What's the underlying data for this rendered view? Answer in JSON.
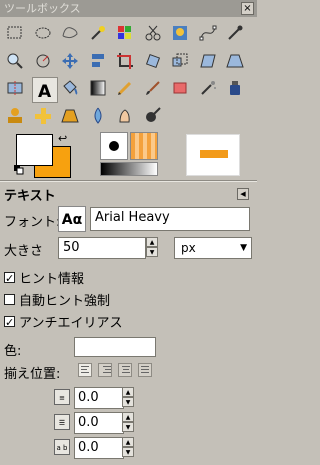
{
  "window": {
    "title": "ツールボックス",
    "close_glyph": "×"
  },
  "tools": [
    {
      "name": "rect-select-icon"
    },
    {
      "name": "ellipse-select-icon"
    },
    {
      "name": "free-select-icon"
    },
    {
      "name": "fuzzy-select-icon"
    },
    {
      "name": "color-select-icon"
    },
    {
      "name": "scissors-select-icon"
    },
    {
      "name": "foreground-select-icon"
    },
    {
      "name": "paths-icon"
    },
    {
      "name": "color-picker-icon"
    },
    {
      "name": "zoom-icon"
    },
    {
      "name": "measure-icon"
    },
    {
      "name": "move-icon"
    },
    {
      "name": "align-icon"
    },
    {
      "name": "crop-icon"
    },
    {
      "name": "rotate-icon"
    },
    {
      "name": "scale-icon"
    },
    {
      "name": "shear-icon"
    },
    {
      "name": "perspective-icon"
    },
    {
      "name": "flip-icon"
    },
    {
      "name": "text-icon"
    },
    {
      "name": "bucket-fill-icon"
    },
    {
      "name": "blend-icon"
    },
    {
      "name": "pencil-icon"
    },
    {
      "name": "paintbrush-icon"
    },
    {
      "name": "eraser-icon"
    },
    {
      "name": "airbrush-icon"
    },
    {
      "name": "ink-icon"
    },
    {
      "name": "clone-icon"
    },
    {
      "name": "heal-icon"
    },
    {
      "name": "perspective-clone-icon"
    },
    {
      "name": "blur-icon"
    },
    {
      "name": "smudge-icon"
    },
    {
      "name": "dodge-burn-icon"
    }
  ],
  "active_tool": "text-icon",
  "colors": {
    "foreground": "#ffffff",
    "background": "#f7a10f",
    "accent_pattern": "#f4a13c"
  },
  "panel": {
    "title": "テキスト",
    "font_label": "フォント:",
    "font_button": "Aα",
    "font_value": "Arial Heavy",
    "size_label": "大きさ",
    "size_value": "50",
    "size_unit": "px",
    "hinting_label": "ヒント情報",
    "hinting_checked": true,
    "autohint_label": "自動ヒント強制",
    "autohint_checked": false,
    "antialias_label": "アンチエイリアス",
    "antialias_checked": true,
    "color_label": "色:",
    "justify_label": "揃え位置:",
    "indent_value": "0.0",
    "line_spacing_value": "0.0",
    "letter_spacing_value": "0.0",
    "letter_spacing_icon": "a b",
    "check_glyph": "✓",
    "spin_up": "▲",
    "spin_down": "▼",
    "combo_arrow": "▼",
    "menu_glyph": "◀"
  }
}
